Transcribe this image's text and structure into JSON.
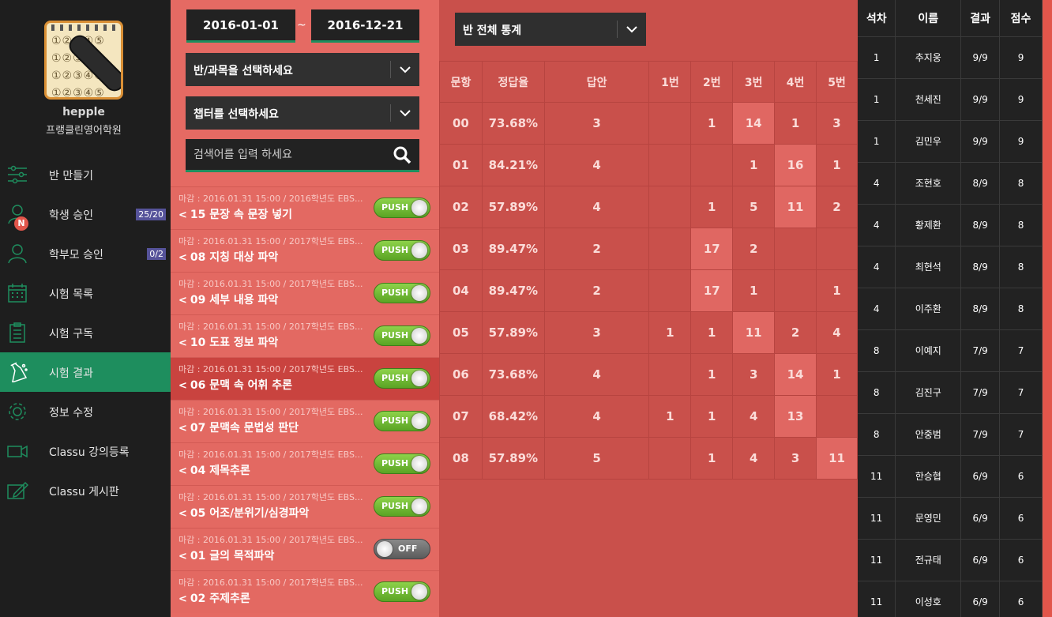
{
  "brand": {
    "name": "hepple",
    "academy": "프랭클린영어학원"
  },
  "nav": [
    {
      "label": "반 만들기",
      "icon": "sliders-icon",
      "badge": ""
    },
    {
      "label": "학생 승인",
      "icon": "user-icon",
      "badge": "25/20",
      "notif": "N"
    },
    {
      "label": "학부모 승인",
      "icon": "user-icon",
      "badge": "0/2"
    },
    {
      "label": "시험 목록",
      "icon": "calendar-icon",
      "badge": ""
    },
    {
      "label": "시험 구독",
      "icon": "clipboard-icon",
      "badge": ""
    },
    {
      "label": "시험 결과",
      "icon": "flask-icon",
      "badge": "",
      "active": true
    },
    {
      "label": "정보 수정",
      "icon": "gear-icon",
      "badge": ""
    },
    {
      "label": "Classu 강의등록",
      "icon": "video-icon",
      "badge": ""
    },
    {
      "label": "Classu 게시판",
      "icon": "pencil-board-icon",
      "badge": ""
    }
  ],
  "filters": {
    "date_from": "2016-01-01",
    "date_sep": "~",
    "date_to": "2016-12-21",
    "class_subject": "반/과목을 선택하세요",
    "chapter": "챕터를 선택하세요",
    "search_placeholder": "검색어를 입력 하세요"
  },
  "exams": [
    {
      "meta": "마감 : 2016.01.31 15:00 / 2016학년도 EBS...",
      "title": "15 문장 속 문장 넣기",
      "push": "PUSH",
      "on": true
    },
    {
      "meta": "마감 : 2016.01.31 15:00 / 2017학년도 EBS...",
      "title": "08 지칭 대상 파악",
      "push": "PUSH",
      "on": true
    },
    {
      "meta": "마감 : 2016.01.31 15:00 / 2017학년도 EBS...",
      "title": "09 세부 내용 파악",
      "push": "PUSH",
      "on": true
    },
    {
      "meta": "마감 : 2016.01.31 15:00 / 2017학년도 EBS...",
      "title": "10 도표 정보 파악",
      "push": "PUSH",
      "on": true
    },
    {
      "meta": "마감 : 2016.01.31 15:00 / 2017학년도 EBS...",
      "title": "06 문맥 속 어휘 추론",
      "push": "PUSH",
      "on": true,
      "active": true
    },
    {
      "meta": "마감 : 2016.01.31 15:00 / 2017학년도 EBS...",
      "title": "07 문맥속 문법성 판단",
      "push": "PUSH",
      "on": true
    },
    {
      "meta": "마감 : 2016.01.31 15:00 / 2017학년도 EBS...",
      "title": "04 제목추론",
      "push": "PUSH",
      "on": true
    },
    {
      "meta": "마감 : 2016.01.31 15:00 / 2017학년도 EBS...",
      "title": "05 어조/분위기/심경파악",
      "push": "PUSH",
      "on": true
    },
    {
      "meta": "마감 : 2016.01.31 15:00 / 2017학년도 EBS...",
      "title": "01 글의 목적파악",
      "push": "OFF",
      "on": false
    },
    {
      "meta": "마감 : 2016.01.31 15:00 / 2017학년도 EBS...",
      "title": "02 주제추론",
      "push": "PUSH",
      "on": true
    }
  ],
  "stats": {
    "select_label": "반 전체 통계",
    "headers": [
      "문항",
      "정답율",
      "답안",
      "1번",
      "2번",
      "3번",
      "4번",
      "5번"
    ],
    "rows": [
      {
        "q": "00",
        "rate": "73.68%",
        "ans": "3",
        "c": [
          "",
          "1",
          "14",
          "1",
          "3"
        ],
        "hl": 3
      },
      {
        "q": "01",
        "rate": "84.21%",
        "ans": "4",
        "c": [
          "",
          "",
          "1",
          "16",
          "1"
        ],
        "hl": 4
      },
      {
        "q": "02",
        "rate": "57.89%",
        "ans": "4",
        "c": [
          "",
          "1",
          "5",
          "11",
          "2"
        ],
        "hl": 4
      },
      {
        "q": "03",
        "rate": "89.47%",
        "ans": "2",
        "c": [
          "",
          "17",
          "2",
          "",
          ""
        ],
        "hl": 2
      },
      {
        "q": "04",
        "rate": "89.47%",
        "ans": "2",
        "c": [
          "",
          "17",
          "1",
          "",
          "1"
        ],
        "hl": 2
      },
      {
        "q": "05",
        "rate": "57.89%",
        "ans": "3",
        "c": [
          "1",
          "1",
          "11",
          "2",
          "4"
        ],
        "hl": 3
      },
      {
        "q": "06",
        "rate": "73.68%",
        "ans": "4",
        "c": [
          "",
          "1",
          "3",
          "14",
          "1"
        ],
        "hl": 4
      },
      {
        "q": "07",
        "rate": "68.42%",
        "ans": "4",
        "c": [
          "1",
          "1",
          "4",
          "13",
          ""
        ],
        "hl": 4
      },
      {
        "q": "08",
        "rate": "57.89%",
        "ans": "5",
        "c": [
          "",
          "1",
          "4",
          "3",
          "11"
        ],
        "hl": 5
      }
    ]
  },
  "ranking": {
    "headers": [
      "석차",
      "이름",
      "결과",
      "점수"
    ],
    "rows": [
      [
        "1",
        "추지웅",
        "9/9",
        "9"
      ],
      [
        "1",
        "천세진",
        "9/9",
        "9"
      ],
      [
        "1",
        "김민우",
        "9/9",
        "9"
      ],
      [
        "4",
        "조현호",
        "8/9",
        "8"
      ],
      [
        "4",
        "황제환",
        "8/9",
        "8"
      ],
      [
        "4",
        "최현석",
        "8/9",
        "8"
      ],
      [
        "4",
        "이주환",
        "8/9",
        "8"
      ],
      [
        "8",
        "이예지",
        "7/9",
        "7"
      ],
      [
        "8",
        "김진구",
        "7/9",
        "7"
      ],
      [
        "8",
        "안중범",
        "7/9",
        "7"
      ],
      [
        "11",
        "한승협",
        "6/9",
        "6"
      ],
      [
        "11",
        "문영민",
        "6/9",
        "6"
      ],
      [
        "11",
        "전규태",
        "6/9",
        "6"
      ],
      [
        "11",
        "이성호",
        "6/9",
        "6"
      ]
    ]
  },
  "colors": {
    "accent": "#1e8e5e",
    "salmon": "#e56a63",
    "stats_bg": "#c9504b",
    "highlight": "#e06762"
  }
}
